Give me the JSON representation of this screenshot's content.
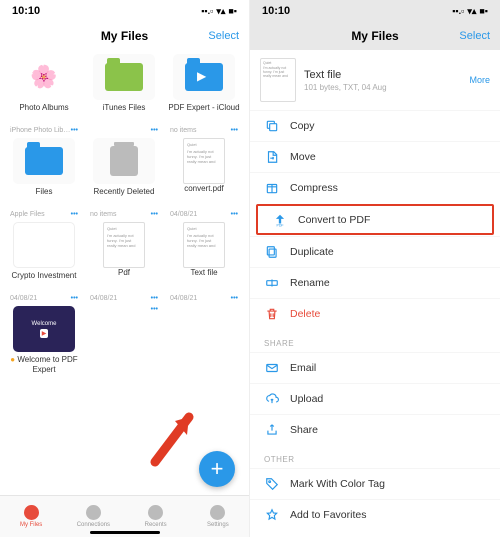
{
  "status": {
    "time": "10:10",
    "signal": "▪▪.▫",
    "wifi": "▾▴",
    "battery": "■▪"
  },
  "header": {
    "title": "My Files",
    "select": "Select"
  },
  "tiles": [
    {
      "name": "Photo Albums",
      "meta": "iPhone Photo Lib…",
      "icon": "photos"
    },
    {
      "name": "iTunes Files",
      "meta": "",
      "icon": "itunes"
    },
    {
      "name": "PDF Expert - iCloud",
      "meta": "no items",
      "icon": "pdfexpert"
    },
    {
      "name": "Files",
      "meta": "Apple Files",
      "icon": "files"
    },
    {
      "name": "Recently Deleted",
      "meta": "no items",
      "icon": "trash"
    },
    {
      "name": "convert.pdf",
      "meta": "04/08/21",
      "icon": "doc",
      "doc_h": "Quiet",
      "doc_b": "I'm actually not funny. I'm just really mean and"
    },
    {
      "name": "Crypto Investment",
      "meta": "04/08/21",
      "icon": "blank"
    },
    {
      "name": "Pdf",
      "meta": "04/08/21",
      "icon": "doc",
      "doc_h": "Quiet",
      "doc_b": "I'm actually not funny. I'm just really mean and"
    },
    {
      "name": "Text file",
      "meta": "04/08/21",
      "icon": "doc",
      "doc_h": "Quiet",
      "doc_b": "I'm actually not funny. I'm just really mean and"
    },
    {
      "name": "Welcome to PDF Expert",
      "meta": "",
      "icon": "welcome",
      "badge": true
    }
  ],
  "tabs": [
    {
      "label": "My Files",
      "active": true
    },
    {
      "label": "Connections",
      "active": false
    },
    {
      "label": "Recents",
      "active": false
    },
    {
      "label": "Settings",
      "active": false
    }
  ],
  "fab": "+",
  "file": {
    "name": "Text file",
    "sub": "101 bytes, TXT, 04 Aug",
    "more": "More",
    "doc_h": "Quiet",
    "doc_b": "I'm actually not funny. I'm just really mean and"
  },
  "actions": [
    {
      "label": "Copy",
      "icon": "copy",
      "id": "copy"
    },
    {
      "label": "Move",
      "icon": "move",
      "id": "move"
    },
    {
      "label": "Compress",
      "icon": "compress",
      "id": "compress"
    },
    {
      "label": "Convert to PDF",
      "icon": "pdf",
      "id": "convert-to-pdf",
      "hl": true
    },
    {
      "label": "Duplicate",
      "icon": "duplicate",
      "id": "duplicate"
    },
    {
      "label": "Rename",
      "icon": "rename",
      "id": "rename"
    },
    {
      "label": "Delete",
      "icon": "delete",
      "id": "delete",
      "del": true
    }
  ],
  "share_h": "SHARE",
  "share": [
    {
      "label": "Email",
      "icon": "mail",
      "id": "email"
    },
    {
      "label": "Upload",
      "icon": "upload",
      "id": "upload"
    },
    {
      "label": "Share",
      "icon": "share",
      "id": "share"
    }
  ],
  "other_h": "OTHER",
  "other": [
    {
      "label": "Mark With Color Tag",
      "icon": "tag",
      "id": "mark-with-color-tag"
    },
    {
      "label": "Add to Favorites",
      "icon": "star",
      "id": "add-to-favorites"
    }
  ]
}
